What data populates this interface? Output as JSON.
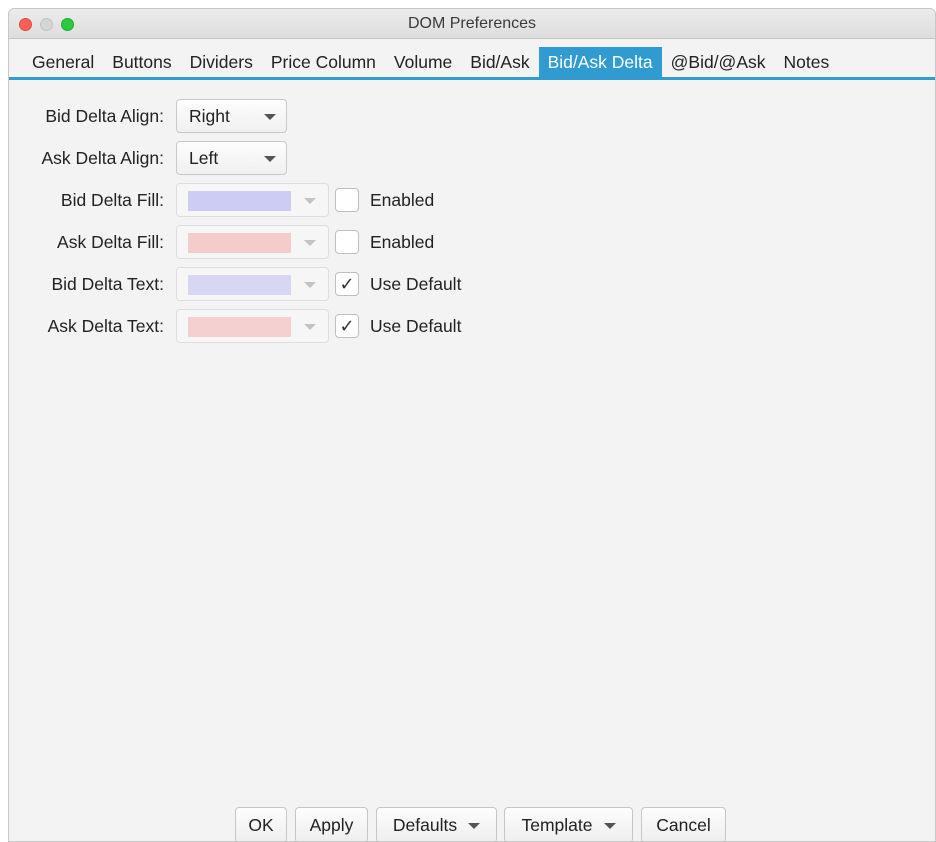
{
  "window": {
    "title": "DOM Preferences"
  },
  "tabs": [
    {
      "label": "General"
    },
    {
      "label": "Buttons"
    },
    {
      "label": "Dividers"
    },
    {
      "label": "Price Column"
    },
    {
      "label": "Volume"
    },
    {
      "label": "Bid/Ask"
    },
    {
      "label": "Bid/Ask Delta",
      "active": true
    },
    {
      "label": "@Bid/@Ask"
    },
    {
      "label": "Notes"
    }
  ],
  "form": {
    "bid_delta_align": {
      "label": "Bid Delta Align:",
      "value": "Right"
    },
    "ask_delta_align": {
      "label": "Ask Delta Align:",
      "value": "Left"
    },
    "bid_delta_fill": {
      "label": "Bid Delta Fill:",
      "color": "#ccccf5",
      "checkbox_label": "Enabled",
      "checked": false
    },
    "ask_delta_fill": {
      "label": "Ask Delta Fill:",
      "color": "#f5cccc",
      "checkbox_label": "Enabled",
      "checked": false
    },
    "bid_delta_text": {
      "label": "Bid Delta Text:",
      "color": "#d7d7f4",
      "checkbox_label": "Use Default",
      "checked": true
    },
    "ask_delta_text": {
      "label": "Ask Delta Text:",
      "color": "#f4d0d0",
      "checkbox_label": "Use Default",
      "checked": true
    }
  },
  "footer": {
    "ok": "OK",
    "apply": "Apply",
    "defaults": "Defaults",
    "template": "Template",
    "cancel": "Cancel"
  },
  "colors": {
    "accent": "#2f9bd1"
  }
}
